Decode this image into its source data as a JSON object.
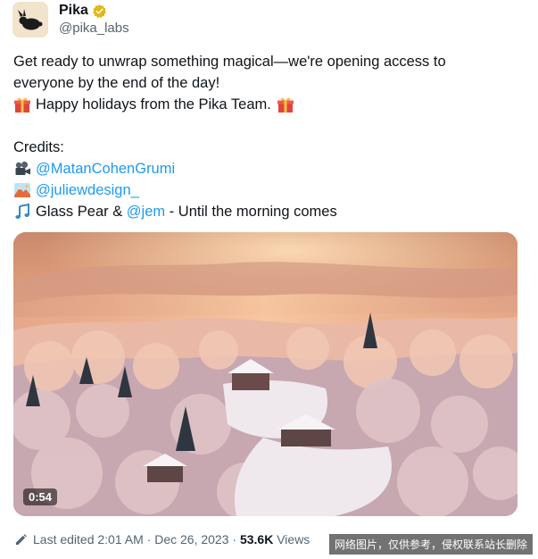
{
  "account": {
    "display_name": "Pika",
    "handle": "@pika_labs",
    "verified_icon": "verified-badge-gold-icon",
    "avatar_icon": "pika-rabbit-logo-icon"
  },
  "post": {
    "line1": "Get ready to unwrap something magical—we're opening access to",
    "line2": "everyone by the end of the day!",
    "line3": "Happy holidays from the Pika Team.",
    "credits_label": "Credits:",
    "credit1_link": "@MatanCohenGrumi",
    "credit2_link": "@juliewdesign_",
    "credit3_prefix": "Glass Pear & ",
    "credit3_link": "@jem",
    "credit3_suffix": " - Until the morning comes"
  },
  "media": {
    "duration": "0:54"
  },
  "footer": {
    "last_edited": "Last edited 2:01 AM",
    "separator1": " · ",
    "date": "Dec 26, 2023",
    "separator2": " · ",
    "views_count": "53.6K",
    "views_label": " Views"
  },
  "watermark": "网络图片，仅供参考，侵权联系站长删除",
  "colors": {
    "link": "#1d9bf0",
    "secondary_text": "#536471",
    "verified_gold": "#e2b719"
  }
}
